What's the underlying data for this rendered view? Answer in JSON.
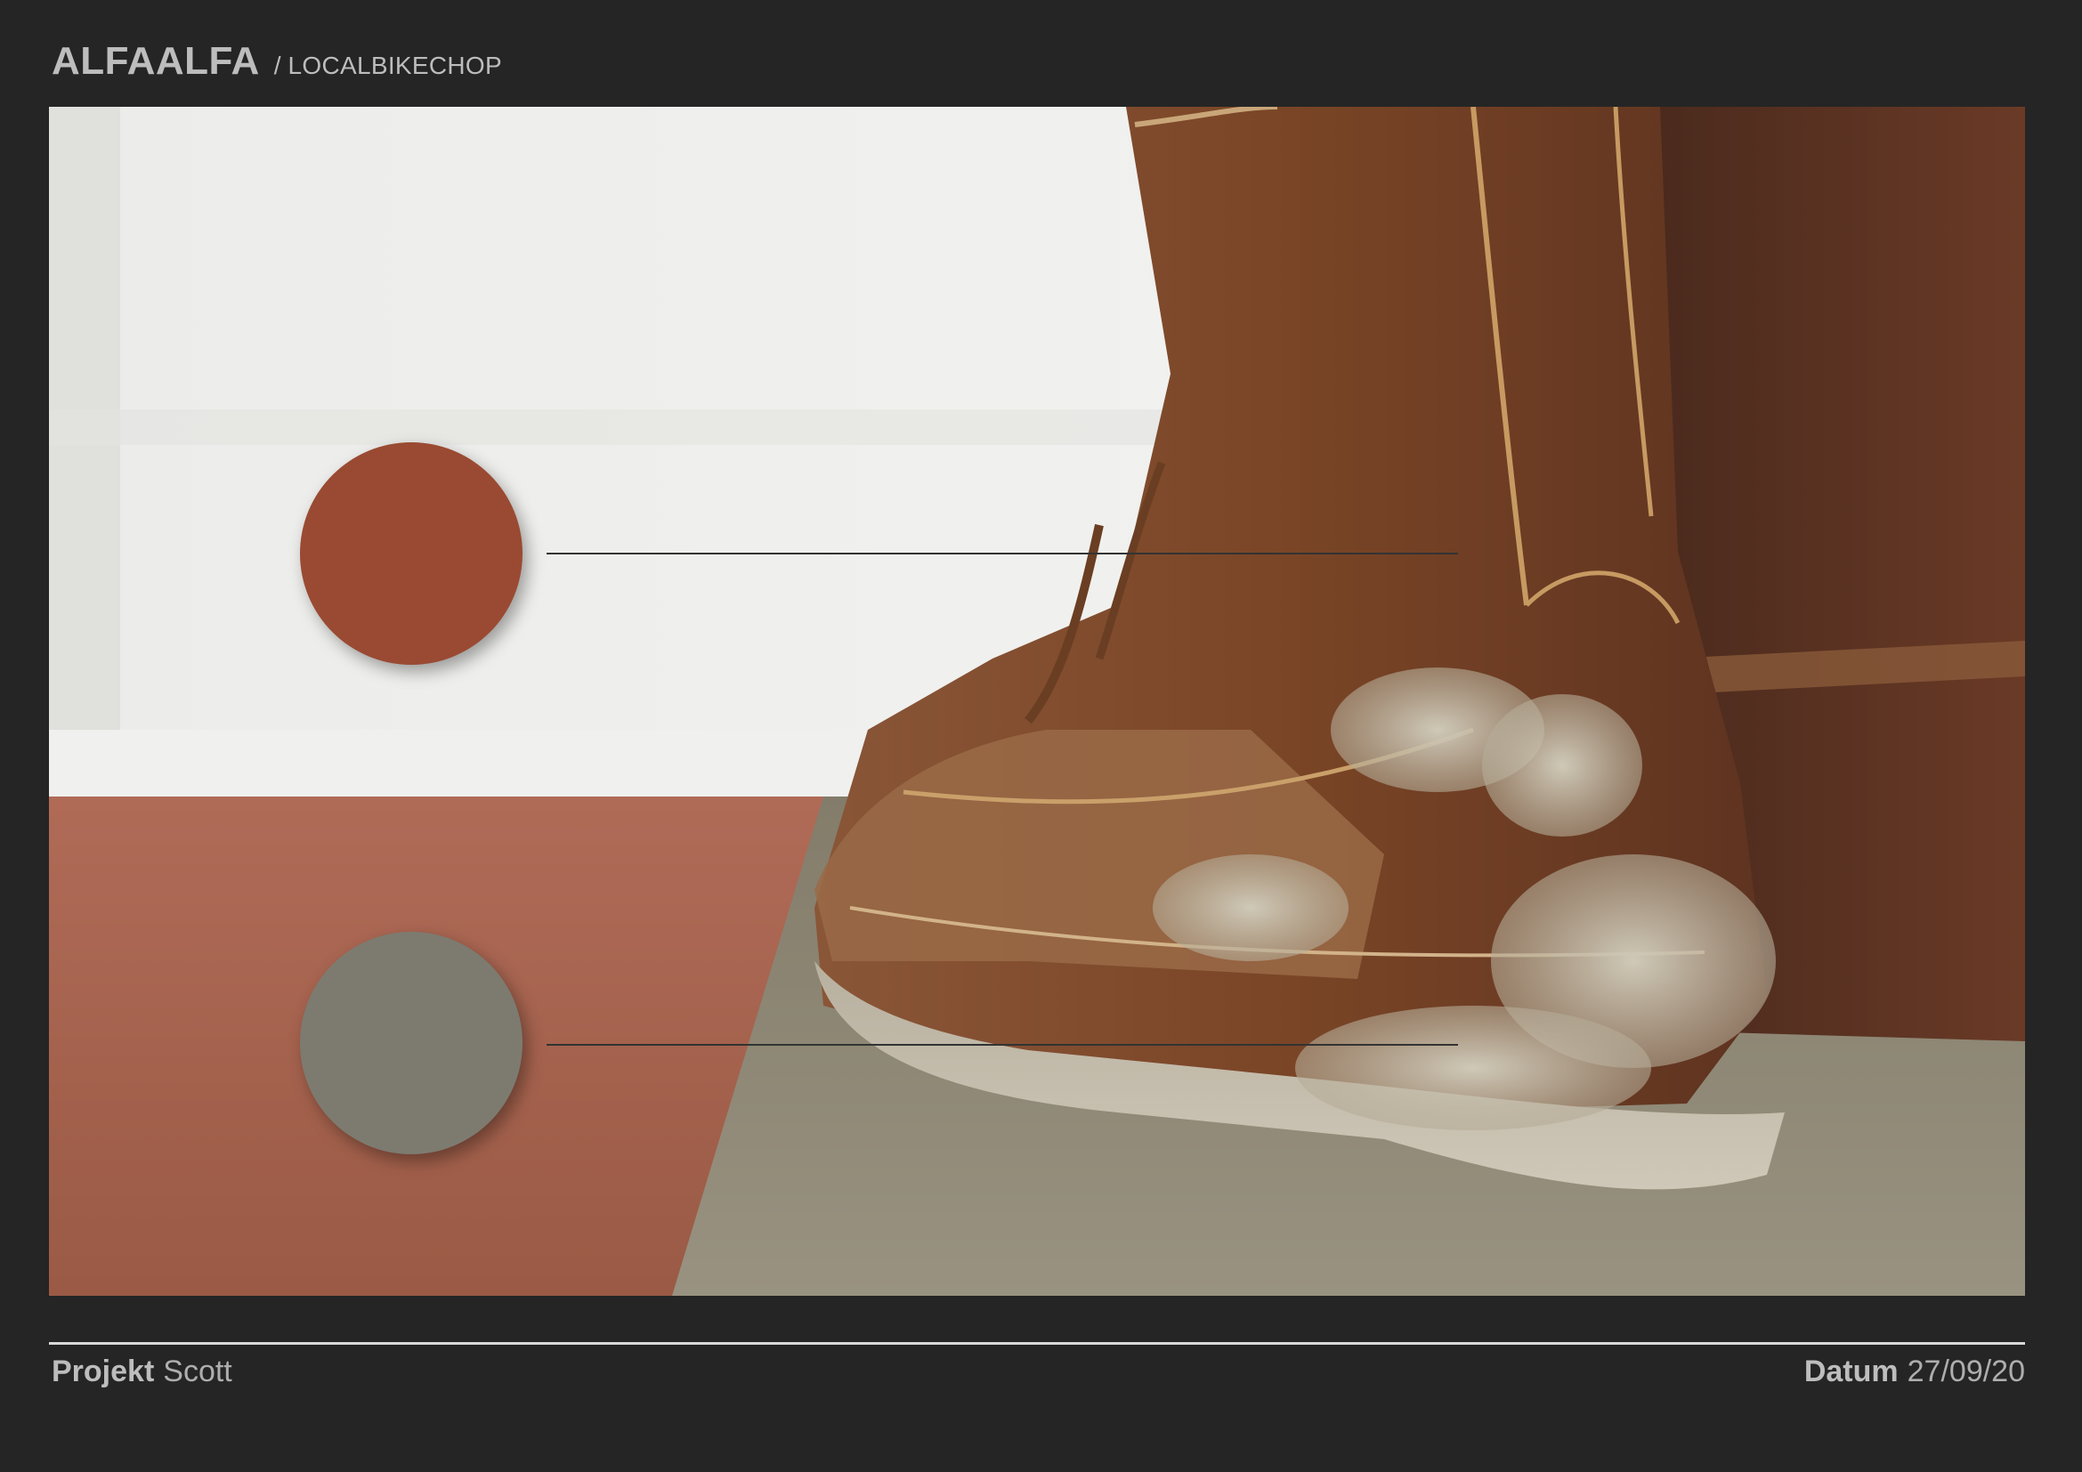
{
  "header": {
    "brand": "ALFAALFA",
    "separator": "/",
    "client": "LOCALBIKECHOP"
  },
  "palette": {
    "swatches": [
      {
        "name": "rust",
        "color": "#9a4a32"
      },
      {
        "name": "grey",
        "color": "#7d7b70"
      }
    ]
  },
  "footer": {
    "project_label": "Projekt",
    "project_value": "Scott",
    "date_label": "Datum",
    "date_value": "27/09/20"
  },
  "colors": {
    "background": "#252525",
    "text": "#bdbdbd",
    "rule": "#d9d9d9"
  }
}
